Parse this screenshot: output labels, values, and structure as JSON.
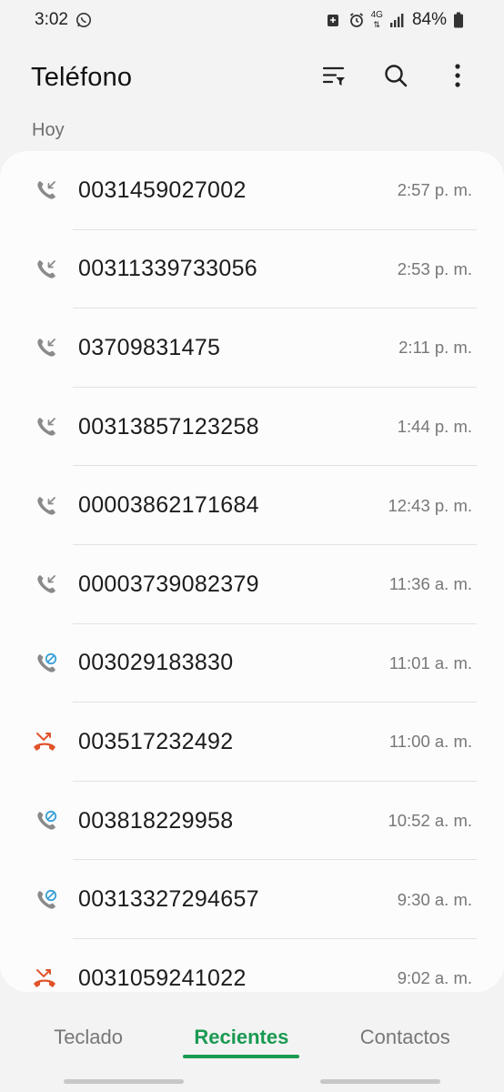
{
  "status_bar": {
    "time": "3:02",
    "left_icons": [
      "whatsapp-icon"
    ],
    "right_icons": [
      "data-saver-icon",
      "alarm-icon",
      "network-4g-icon",
      "signal-icon",
      "battery-icon"
    ],
    "network": "4G",
    "battery": "84%"
  },
  "header": {
    "title": "Teléfono",
    "actions": [
      "filter-icon",
      "search-icon",
      "more-options-icon"
    ]
  },
  "section": {
    "label": "Hoy"
  },
  "calls": [
    {
      "number": "0031459027002",
      "time": "2:57 p. m.",
      "type": "incoming",
      "icon": "incoming-call-icon"
    },
    {
      "number": "00311339733056",
      "time": "2:53 p. m.",
      "type": "incoming",
      "icon": "incoming-call-icon"
    },
    {
      "number": "03709831475",
      "time": "2:11 p. m.",
      "type": "incoming",
      "icon": "incoming-call-icon"
    },
    {
      "number": "00313857123258",
      "time": "1:44 p. m.",
      "type": "incoming",
      "icon": "incoming-call-icon"
    },
    {
      "number": "00003862171684",
      "time": "12:43 p. m.",
      "type": "incoming",
      "icon": "incoming-call-icon"
    },
    {
      "number": "00003739082379",
      "time": "11:36 a. m.",
      "type": "incoming",
      "icon": "incoming-call-icon"
    },
    {
      "number": "003029183830",
      "time": "11:01 a. m.",
      "type": "blocked",
      "icon": "blocked-call-icon"
    },
    {
      "number": "003517232492",
      "time": "11:00 a. m.",
      "type": "missed",
      "icon": "missed-call-icon"
    },
    {
      "number": "003818229958",
      "time": "10:52 a. m.",
      "type": "blocked",
      "icon": "blocked-call-icon"
    },
    {
      "number": "00313327294657",
      "time": "9:30 a. m.",
      "type": "blocked",
      "icon": "blocked-call-icon"
    },
    {
      "number": "0031059241022",
      "time": "9:02 a. m.",
      "type": "missed",
      "icon": "missed-call-icon"
    }
  ],
  "bottom_nav": {
    "tabs": [
      {
        "label": "Teclado",
        "active": false
      },
      {
        "label": "Recientes",
        "active": true
      },
      {
        "label": "Contactos",
        "active": false
      }
    ]
  },
  "colors": {
    "accent": "#1a9a52",
    "missed": "#e0532b",
    "blocked": "#3aa0d8",
    "incoming": "#8a8a8a"
  }
}
